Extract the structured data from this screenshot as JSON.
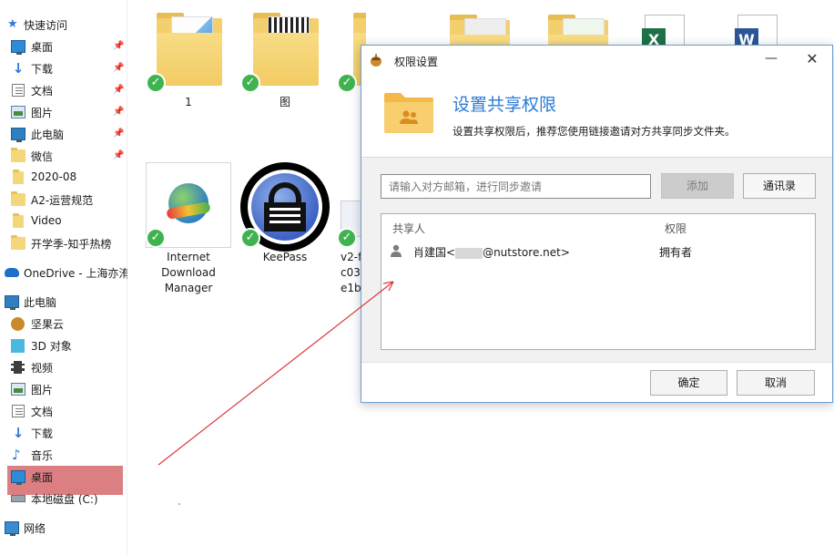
{
  "sidebar": {
    "quick_access": "快速访问",
    "pinned": [
      {
        "label": "桌面",
        "icon": "desktop-icon"
      },
      {
        "label": "下载",
        "icon": "download-icon"
      },
      {
        "label": "文档",
        "icon": "document-icon"
      },
      {
        "label": "图片",
        "icon": "picture-icon"
      },
      {
        "label": "此电脑",
        "icon": "computer-icon"
      },
      {
        "label": "微信",
        "icon": "folder-icon"
      }
    ],
    "recent": [
      {
        "label": "2020-08",
        "icon": "folder-icon"
      },
      {
        "label": "A2-运营规范",
        "icon": "folder-icon"
      },
      {
        "label": "Video",
        "icon": "folder-icon"
      },
      {
        "label": "开学季-知乎热榜",
        "icon": "folder-icon"
      }
    ],
    "onedrive": "OneDrive - 上海亦洧",
    "this_pc": "此电脑",
    "pc_items": [
      {
        "label": "坚果云",
        "icon": "nutstore-icon"
      },
      {
        "label": "3D 对象",
        "icon": "3d-objects-icon"
      },
      {
        "label": "视频",
        "icon": "video-icon"
      },
      {
        "label": "图片",
        "icon": "picture-icon"
      },
      {
        "label": "文档",
        "icon": "document-icon"
      },
      {
        "label": "下载",
        "icon": "download-icon"
      },
      {
        "label": "音乐",
        "icon": "music-icon"
      },
      {
        "label": "桌面",
        "icon": "desktop-icon"
      },
      {
        "label": "本地磁盘 (C:)",
        "icon": "drive-icon"
      }
    ],
    "network": "网络"
  },
  "files": [
    {
      "caption": "1"
    },
    {
      "caption": "图"
    },
    {
      "caption": "Internet\nDownload\nManager"
    },
    {
      "caption": "KeePass"
    },
    {
      "caption": "v2-f\nc03\ne1b"
    }
  ],
  "dialog": {
    "title": "权限设置",
    "heading": "设置共享权限",
    "subtitle": "设置共享权限后，推荐您使用链接邀请对方共享同步文件夹。",
    "input_placeholder": "请输入对方邮箱，进行同步邀请",
    "add_button": "添加",
    "contacts_button": "通讯录",
    "col_sharer": "共享人",
    "col_permission": "权限",
    "rows": [
      {
        "name_prefix": "肖建国<",
        "name_suffix": "@nutstore.net>",
        "permission": "拥有者"
      }
    ],
    "ok_button": "确定",
    "cancel_button": "取消"
  },
  "colors": {
    "accent": "#2b7bd6",
    "check_green": "#3fb34f",
    "selection_red": "#d9787c",
    "arrow_red": "#d9363e"
  }
}
